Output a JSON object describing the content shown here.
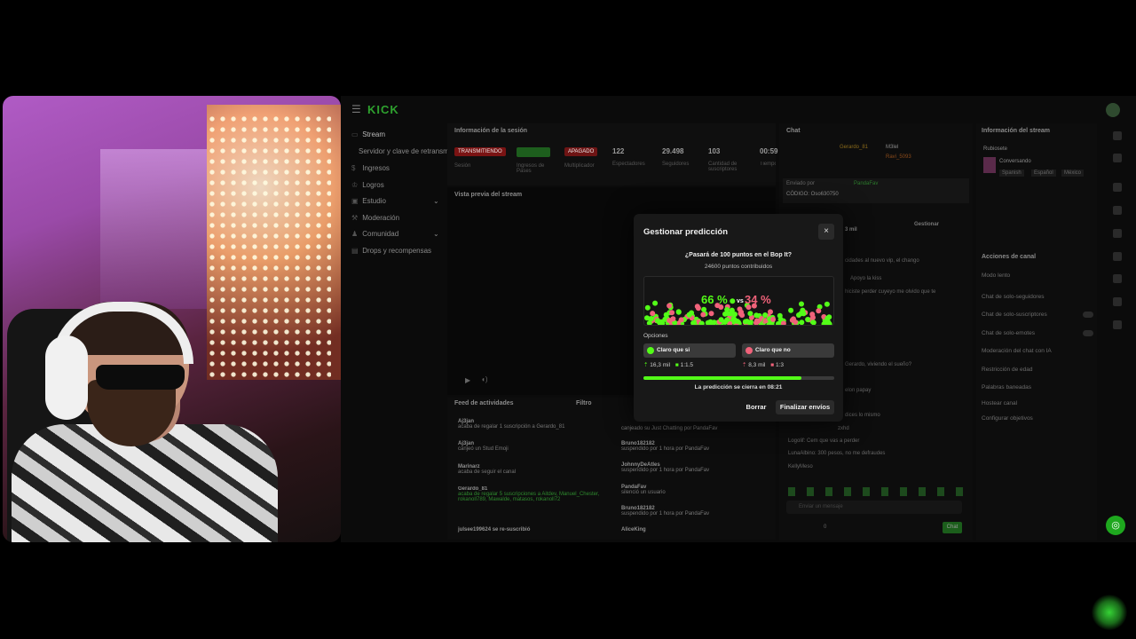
{
  "app": {
    "logo": "KICK"
  },
  "sidebar": {
    "items": [
      {
        "label": "Stream"
      },
      {
        "label": "Servidor y clave de retransm"
      },
      {
        "label": "Ingresos"
      },
      {
        "label": "Logros"
      },
      {
        "label": "Estudio"
      },
      {
        "label": "Moderación"
      },
      {
        "label": "Comunidad"
      },
      {
        "label": "Drops y recompensas"
      }
    ]
  },
  "session": {
    "title": "Información de la sesión",
    "badges": [
      "TRANSMITIENDO",
      "",
      "APAGADO"
    ],
    "stats": [
      {
        "value": "122",
        "label": "Espectadores"
      },
      {
        "value": "29.498",
        "label": "Seguidores"
      },
      {
        "value": "103",
        "label": "Cantidad de suscriptores"
      },
      {
        "value": "00:59",
        "label": "Tiempo"
      }
    ],
    "labels": [
      "Sesión",
      "Ingresos de Pases",
      "Multiplicador"
    ]
  },
  "preview": {
    "title": "Vista previa del stream"
  },
  "feed": {
    "title": "Feed de actividades",
    "filter": "Filtro",
    "left": [
      {
        "name": "Aj3jan",
        "sub": "acaba de regalar 1 suscripción a Gerardo_81",
        "time": "hace 2 minutos"
      },
      {
        "name": "Aj3jan",
        "sub": "canjeó un Stud Emoji",
        "time": "hace 3 minutos"
      },
      {
        "name": "Marinarz",
        "sub": "acaba de seguir el canal",
        "time": "hace 4 minutos"
      },
      {
        "name": "Gerardo_81",
        "sub": "acaba de regalar 5 suscripciones a Aitdev, Manuel_Chester, rokanoll789, Mawalde, matasos, rokanoll72",
        "time": "hace 10 minutos"
      },
      {
        "name": "julsee199624 se re-suscribió",
        "sub": "",
        "time": "hace 11 minutos"
      }
    ],
    "right": [
      {
        "name": "",
        "sub": "canjeado su Just Chatting por PandaFav",
        "time": "hace 18 horas"
      },
      {
        "name": "Bruno182182",
        "sub": "suspendido por 1 hora por PandaFav",
        "time": "hace 18 horas"
      },
      {
        "name": "JohnnyDeAtles",
        "sub": "suspendido por 1 hora por PandaFav",
        "time": "hace 19 horas"
      },
      {
        "name": "PandaFav",
        "sub": "silenció un usuario",
        "time": "hace 19 horas"
      },
      {
        "name": "Bruno182182",
        "sub": "suspendido por 1 hora por PandaFav",
        "time": "hace 20 horas"
      },
      {
        "name": "AliceKing",
        "sub": "",
        "time": "hace 20 horas"
      }
    ]
  },
  "chat": {
    "title": "Chat",
    "top_users": [
      "Gerardo_81",
      "M3lel",
      "Ravi_5093"
    ],
    "pinned_by": "Enviado por",
    "pinned_user": "PandaFav",
    "code": "CÓDIGO: Oso630750",
    "manage": "Gestionar",
    "amount": "3 mil",
    "lines": [
      "cidades al nuevo vip, el chango",
      "Apoyo la kiss",
      "hiciste perder cuyeyo me olvido que te",
      "Gerardo, viviendo el sueño?",
      "elon papay",
      "dices lo mismo",
      "zxhd",
      "Logolif: Cem que vas a perder",
      "LunaAlbino: 300 pesos, no me defraudes",
      "KellyMeso"
    ],
    "input_placeholder": "Enviar un mensaje",
    "send": "Chat",
    "count": "0"
  },
  "stream_info": {
    "title": "Información del stream",
    "category_label": "Rubiosete",
    "category": "Conversando",
    "tags": [
      "Spanish",
      "Español",
      "México"
    ]
  },
  "channel_actions": {
    "title": "Acciones de canal",
    "items": [
      "Modo lento",
      "Chat de solo-seguidores",
      "Chat de solo-suscriptores",
      "Chat de solo-emotes",
      "Moderación del chat con IA",
      "Restricción de edad",
      "Palabras baneadas",
      "Hostear canal",
      "Configurar objetivos"
    ]
  },
  "modal": {
    "title": "Gestionar predicción",
    "close": "×",
    "question": "¿Pasará de 100 puntos en el Bop It?",
    "points": "24600 puntos contribuidos",
    "pct_yes": "66 %",
    "vs": "vs",
    "pct_no": "34 %",
    "options_label": "Opciones",
    "options": [
      {
        "label": "Claro que si",
        "amount": "16,3 mil",
        "ratio": "1:1.5",
        "color": "#53fc18"
      },
      {
        "label": "Claro que no",
        "amount": "8,3 mil",
        "ratio": "1:3",
        "color": "#f0627a"
      }
    ],
    "progress": 0.83,
    "closes_in": "La predicción se cierra en 08:21",
    "delete": "Borrar",
    "finish": "Finalizar envíos"
  }
}
